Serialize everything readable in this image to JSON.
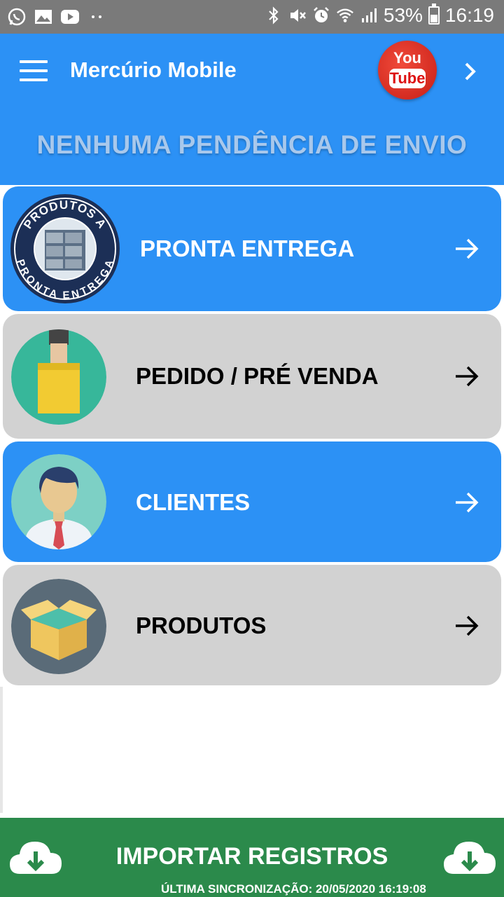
{
  "status_bar": {
    "battery": "53%",
    "time": "16:19",
    "left_icons": [
      "whatsapp-icon",
      "image-icon",
      "youtube-icon",
      "more-dots-icon"
    ],
    "right_icons": [
      "bluetooth-icon",
      "mute-icon",
      "alarm-icon",
      "wifi-icon",
      "signal-icon",
      "battery-icon"
    ]
  },
  "appbar": {
    "title": "Mercúrio Mobile",
    "youtube_top": "You",
    "youtube_bottom": "Tube",
    "pending_message": "NENHUMA PENDÊNCIA DE ENVIO"
  },
  "menu": {
    "items": [
      {
        "label": "PRONTA ENTREGA",
        "icon": "produtos-a-pronta-entrega-badge",
        "badge_top": "PRODUTOS A",
        "badge_bottom": "PRONTA ENTREGA",
        "style": "blue"
      },
      {
        "label": "PEDIDO / PRÉ VENDA",
        "icon": "shopping-bag-icon",
        "style": "gray"
      },
      {
        "label": "CLIENTES",
        "icon": "user-avatar-icon",
        "style": "blue"
      },
      {
        "label": "PRODUTOS",
        "icon": "open-box-icon",
        "style": "gray"
      }
    ]
  },
  "footer": {
    "import_label": "IMPORTAR REGISTROS",
    "last_sync": "ÚLTIMA SINCRONIZAÇÃO: 20/05/2020 16:19:08"
  },
  "colors": {
    "primary_blue": "#2c91f5",
    "card_gray": "#d2d2d2",
    "footer_green": "#2b8a4b"
  }
}
